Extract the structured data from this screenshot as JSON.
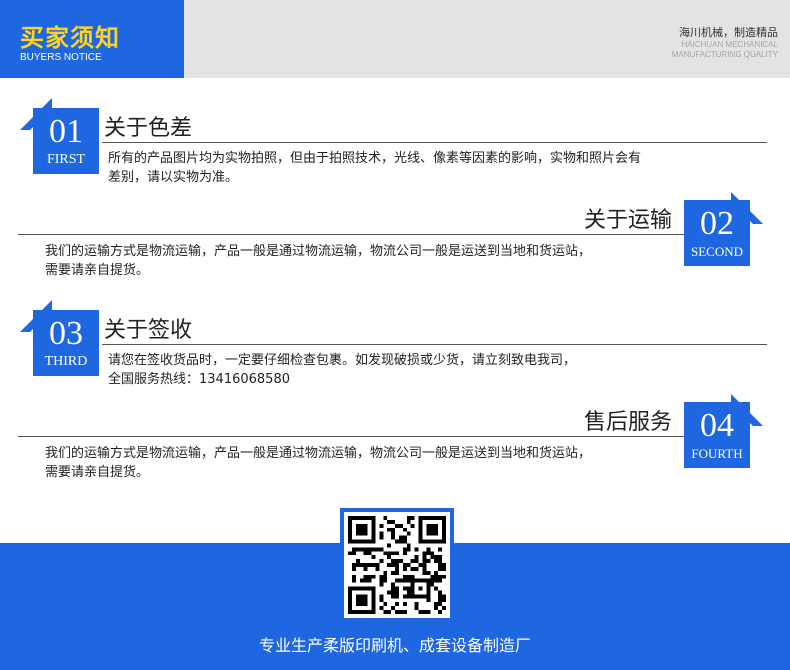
{
  "header": {
    "title": "买家须知",
    "subtitle": "BUYERS NOTICE",
    "slogan": "海川机械，制造精品",
    "slogan_en_line1": "HAICHUAN MECHANICAL",
    "slogan_en_line2": "MANUFACTURING QUALITY"
  },
  "sections": [
    {
      "number": "01",
      "number_word": "FIRST",
      "title": "关于色差",
      "text_line1": "所有的产品图片均为实物拍照，但由于拍照技术，光线、像素等因素的影响，实物和照片会有",
      "text_line2": "差别，请以实物为准。"
    },
    {
      "number": "02",
      "number_word": "SECOND",
      "title": "关于运输",
      "text_line1": "我们的运输方式是物流运输，产品一般是通过物流运输，物流公司一般是运送到当地和货运站，",
      "text_line2": "需要请亲自提货。"
    },
    {
      "number": "03",
      "number_word": "THIRD",
      "title": "关于签收",
      "text_line1": "请您在签收货品时，一定要仔细检查包裹。如发现破损或少货，请立刻致电我司，",
      "text_line2": "全国服务热线：13416068580"
    },
    {
      "number": "04",
      "number_word": "FOURTH",
      "title": "售后服务",
      "text_line1": "我们的运输方式是物流运输，产品一般是通过物流运输，物流公司一般是运送到当地和货运站，",
      "text_line2": "需要请亲自提货。"
    }
  ],
  "footer": {
    "tagline": "专业生产柔版印刷机、成套设备制造厂"
  },
  "colors": {
    "brand_blue": "#1e67e0",
    "header_title_yellow": "#ffd320",
    "header_gray": "#e3e3e3"
  }
}
